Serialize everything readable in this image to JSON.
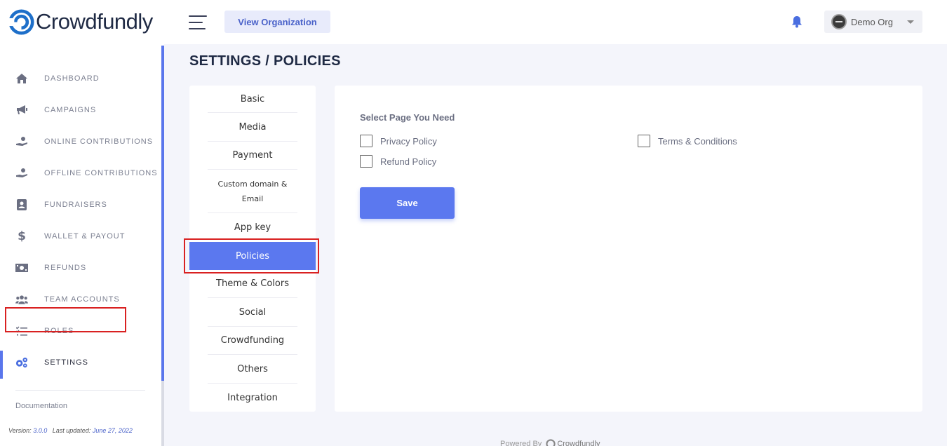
{
  "header": {
    "logo_text": "Crowdfundly",
    "view_org_label": "View Organization",
    "org_name": "Demo Org"
  },
  "sidebar": {
    "items": [
      {
        "label": "DASHBOARD",
        "icon": "home-icon"
      },
      {
        "label": "CAMPAIGNS",
        "icon": "megaphone-icon"
      },
      {
        "label": "ONLINE CONTRIBUTIONS",
        "icon": "hand-coin-icon"
      },
      {
        "label": "OFFLINE CONTRIBUTIONS",
        "icon": "hand-coin-icon"
      },
      {
        "label": "FUNDRAISERS",
        "icon": "contact-card-icon"
      },
      {
        "label": "WALLET & PAYOUT",
        "icon": "dollar-icon"
      },
      {
        "label": "REFUNDS",
        "icon": "money-bill-icon"
      },
      {
        "label": "TEAM ACCOUNTS",
        "icon": "users-icon"
      },
      {
        "label": "ROLES",
        "icon": "checklist-icon"
      },
      {
        "label": "SETTINGS",
        "icon": "gears-icon",
        "active": true
      }
    ],
    "documentation_label": "Documentation",
    "version_prefix": "Version:",
    "version": "3.0.0",
    "updated_prefix": "Last updated:",
    "updated_date": "June 27, 2022"
  },
  "page": {
    "title": "SETTINGS / POLICIES"
  },
  "settings_tabs": {
    "items": [
      "Basic",
      "Media",
      "Payment",
      "Custom domain &",
      "Email",
      "App key",
      "Policies",
      "Theme & Colors",
      "Social",
      "Crowdfunding",
      "Others",
      "Integration"
    ],
    "active": "Policies"
  },
  "policies": {
    "section_label": "Select Page You Need",
    "options": [
      {
        "label": "Privacy Policy",
        "checked": false
      },
      {
        "label": "Terms & Conditions",
        "checked": false
      },
      {
        "label": "Refund Policy",
        "checked": false
      }
    ],
    "save_label": "Save"
  },
  "footer": {
    "powered_by": "Powered By",
    "brand": "Crowdfundly"
  },
  "colors": {
    "accent": "#5b78ef",
    "highlight": "#d92121",
    "brand_logo": "#1e6fc9"
  }
}
